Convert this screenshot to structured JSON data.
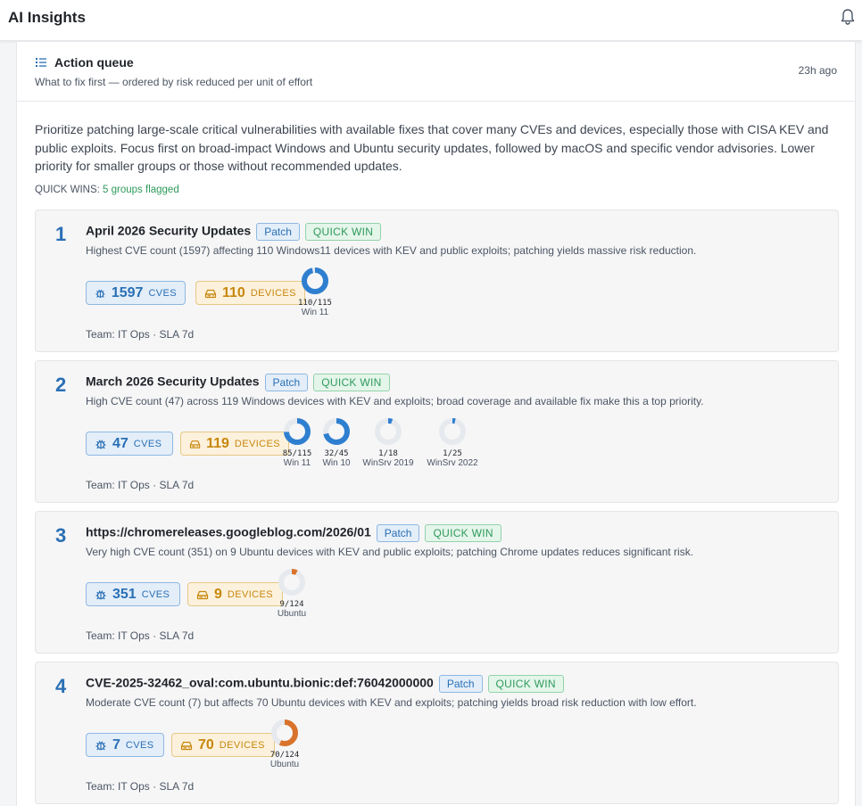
{
  "header": {
    "title": "AI Insights",
    "bell_icon": "bell-icon"
  },
  "queue": {
    "title": "Action queue",
    "subtitle": "What to fix first — ordered by risk reduced per unit of effort",
    "updated": "23h ago",
    "summary": "Prioritize patching large-scale critical vulnerabilities with available fixes that cover many CVEs and devices, especially those with CISA KEV and public exploits. Focus first on broad-impact Windows and Ubuntu security updates, followed by macOS and specific vendor advisories. Lower priority for smaller groups or those without recommended updates.",
    "quick_wins_label": "QUICK WINS:",
    "quick_wins_value": "5 groups flagged",
    "colors": {
      "accent_blue": "#2a6fb5",
      "quick_win_green": "#2f9a5c",
      "devices_amber": "#c7870c",
      "donut_blue": "#2f7fd0",
      "donut_orange": "#d9732b"
    }
  },
  "items": [
    {
      "rank": "1",
      "title": "April 2026 Security Updates",
      "tag_patch": "Patch",
      "tag_quickwin": "QUICK WIN",
      "desc": "Highest CVE count (1597) affecting 110 Windows11 devices with KEV and public exploits; patching yields massive risk reduction.",
      "cves": "1597",
      "cves_label": "CVES",
      "devices": "110",
      "devices_label": "DEVICES",
      "team": "Team: IT Ops · SLA 7d",
      "platforms": [
        {
          "fraction": "110/115",
          "os": "Win 11",
          "share": 0.957,
          "color": "#2f7fd0"
        }
      ]
    },
    {
      "rank": "2",
      "title": "March 2026 Security Updates",
      "tag_patch": "Patch",
      "tag_quickwin": "QUICK WIN",
      "desc": "High CVE count (47) across 119 Windows devices with KEV and exploits; broad coverage and available fix make this a top priority.",
      "cves": "47",
      "cves_label": "CVES",
      "devices": "119",
      "devices_label": "DEVICES",
      "team": "Team: IT Ops · SLA 7d",
      "platforms": [
        {
          "fraction": "85/115",
          "os": "Win 11",
          "share": 0.739,
          "color": "#2f7fd0"
        },
        {
          "fraction": "32/45",
          "os": "Win 10",
          "share": 0.711,
          "color": "#2f7fd0"
        },
        {
          "fraction": "1/18",
          "os": "WinSrv 2019",
          "share": 0.056,
          "color": "#2f7fd0"
        },
        {
          "fraction": "1/25",
          "os": "WinSrv 2022",
          "share": 0.04,
          "color": "#2f7fd0"
        }
      ]
    },
    {
      "rank": "3",
      "title": "https://chromereleases.googleblog.com/2026/01",
      "tag_patch": "Patch",
      "tag_quickwin": "QUICK WIN",
      "desc": "Very high CVE count (351) on 9 Ubuntu devices with KEV and public exploits; patching Chrome updates reduces significant risk.",
      "cves": "351",
      "cves_label": "CVES",
      "devices": "9",
      "devices_label": "DEVICES",
      "team": "Team: IT Ops · SLA 7d",
      "platforms": [
        {
          "fraction": "9/124",
          "os": "Ubuntu",
          "share": 0.073,
          "color": "#d9732b"
        }
      ]
    },
    {
      "rank": "4",
      "title": "CVE-2025-32462_oval:com.ubuntu.bionic:def:76042000000",
      "tag_patch": "Patch",
      "tag_quickwin": "QUICK WIN",
      "desc": "Moderate CVE count (7) but affects 70 Ubuntu devices with KEV and exploits; patching yields broad risk reduction with low effort.",
      "cves": "7",
      "cves_label": "CVES",
      "devices": "70",
      "devices_label": "DEVICES",
      "team": "Team: IT Ops · SLA 7d",
      "platforms": [
        {
          "fraction": "70/124",
          "os": "Ubuntu",
          "share": 0.565,
          "color": "#d9732b"
        }
      ]
    }
  ]
}
